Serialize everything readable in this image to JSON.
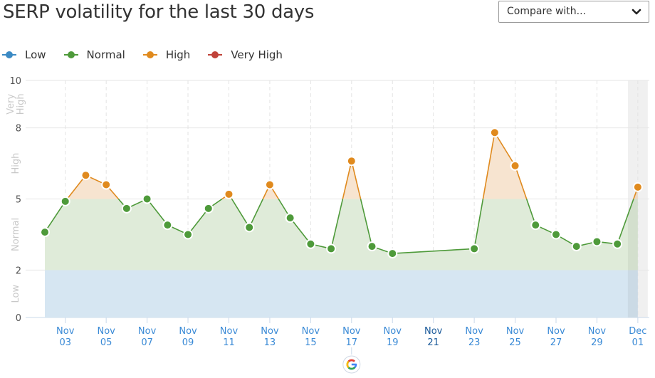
{
  "header": {
    "title": "SERP volatility for the last 30 days",
    "compare_select": {
      "value": "Compare with...",
      "icon": "chevron-down-icon"
    }
  },
  "legend": [
    {
      "label": "Low",
      "color": "#3b8ac4"
    },
    {
      "label": "Normal",
      "color": "#4e9a3a"
    },
    {
      "label": "High",
      "color": "#e08a1e"
    },
    {
      "label": "Very High",
      "color": "#c0433a"
    }
  ],
  "chart_data": {
    "type": "line",
    "title": "SERP volatility for the last 30 days",
    "xlabel": "",
    "ylabel": "",
    "ylim": [
      0,
      10
    ],
    "yticks": [
      0,
      2,
      5,
      8,
      10
    ],
    "bands": [
      {
        "label": "Low",
        "from": 0,
        "to": 2,
        "color": "#d6e6f2"
      },
      {
        "label": "Normal",
        "from": 2,
        "to": 5,
        "color": "#dfebd9"
      },
      {
        "label": "High",
        "from": 5,
        "to": 8,
        "color": "#f7e4d0"
      },
      {
        "label": "Very High",
        "from": 8,
        "to": 10,
        "color": "#f3dbd9"
      }
    ],
    "band_labels": [
      "Low",
      "Normal",
      "High",
      "Very High"
    ],
    "x_tick_labels": [
      [
        "Nov",
        "03"
      ],
      [
        "Nov",
        "05"
      ],
      [
        "Nov",
        "07"
      ],
      [
        "Nov",
        "09"
      ],
      [
        "Nov",
        "11"
      ],
      [
        "Nov",
        "13"
      ],
      [
        "Nov",
        "15"
      ],
      [
        "Nov",
        "17"
      ],
      [
        "Nov",
        "19"
      ],
      [
        "Nov",
        "21"
      ],
      [
        "Nov",
        "23"
      ],
      [
        "Nov",
        "25"
      ],
      [
        "Nov",
        "27"
      ],
      [
        "Nov",
        "29"
      ],
      [
        "Dec",
        "01"
      ]
    ],
    "x_tick_days": [
      1,
      3,
      5,
      7,
      9,
      11,
      13,
      15,
      17,
      19,
      21,
      23,
      25,
      27,
      29
    ],
    "highlighted_tick": "Nov 21",
    "x": [
      "Nov 02",
      "Nov 03",
      "Nov 04",
      "Nov 05",
      "Nov 06",
      "Nov 07",
      "Nov 08",
      "Nov 09",
      "Nov 10",
      "Nov 11",
      "Nov 12",
      "Nov 13",
      "Nov 14",
      "Nov 15",
      "Nov 16",
      "Nov 17",
      "Nov 18",
      "Nov 19",
      "Nov 23",
      "Nov 24",
      "Nov 25",
      "Nov 26",
      "Nov 27",
      "Nov 28",
      "Nov 29",
      "Nov 30",
      "Dec 01"
    ],
    "day_index": [
      0,
      1,
      2,
      3,
      4,
      5,
      6,
      7,
      8,
      9,
      10,
      11,
      12,
      13,
      14,
      15,
      16,
      17,
      21,
      22,
      23,
      24,
      25,
      26,
      27,
      28,
      29
    ],
    "series": [
      {
        "name": "SERP volatility",
        "values": [
          3.6,
          4.9,
          6.0,
          5.6,
          4.6,
          5.0,
          3.9,
          3.5,
          4.6,
          5.2,
          3.8,
          5.6,
          4.2,
          3.1,
          2.9,
          6.6,
          3.0,
          2.7,
          2.9,
          7.8,
          6.4,
          3.9,
          3.5,
          3.0,
          3.2,
          3.1,
          5.5
        ]
      }
    ],
    "annotations": [
      {
        "day": "Nov 17",
        "label": "Google update",
        "icon": "google-icon"
      }
    ],
    "highlighted_range": "Dec 01",
    "grid": true,
    "legend_position": "top-left"
  }
}
